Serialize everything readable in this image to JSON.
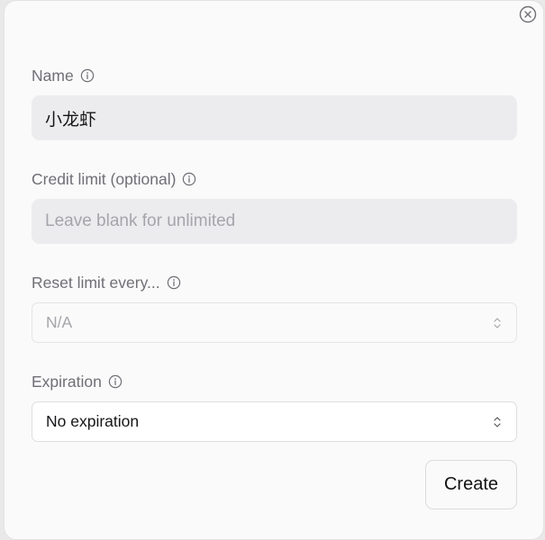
{
  "form": {
    "name": {
      "label": "Name",
      "value": "小龙虾",
      "icon": "info-icon"
    },
    "credit_limit": {
      "label": "Credit limit (optional)",
      "value": "",
      "placeholder": "Leave blank for unlimited",
      "icon": "info-icon"
    },
    "reset_limit": {
      "label": "Reset limit every...",
      "selected": "N/A",
      "disabled": true,
      "icon": "info-icon"
    },
    "expiration": {
      "label": "Expiration",
      "selected": "No expiration",
      "icon": "info-icon"
    }
  },
  "actions": {
    "create_label": "Create",
    "close_icon": "close-circle-icon"
  },
  "colors": {
    "label": "#6f6f76",
    "input_bg": "#ececee",
    "placeholder": "#a5a5ab",
    "text": "#17171a"
  }
}
